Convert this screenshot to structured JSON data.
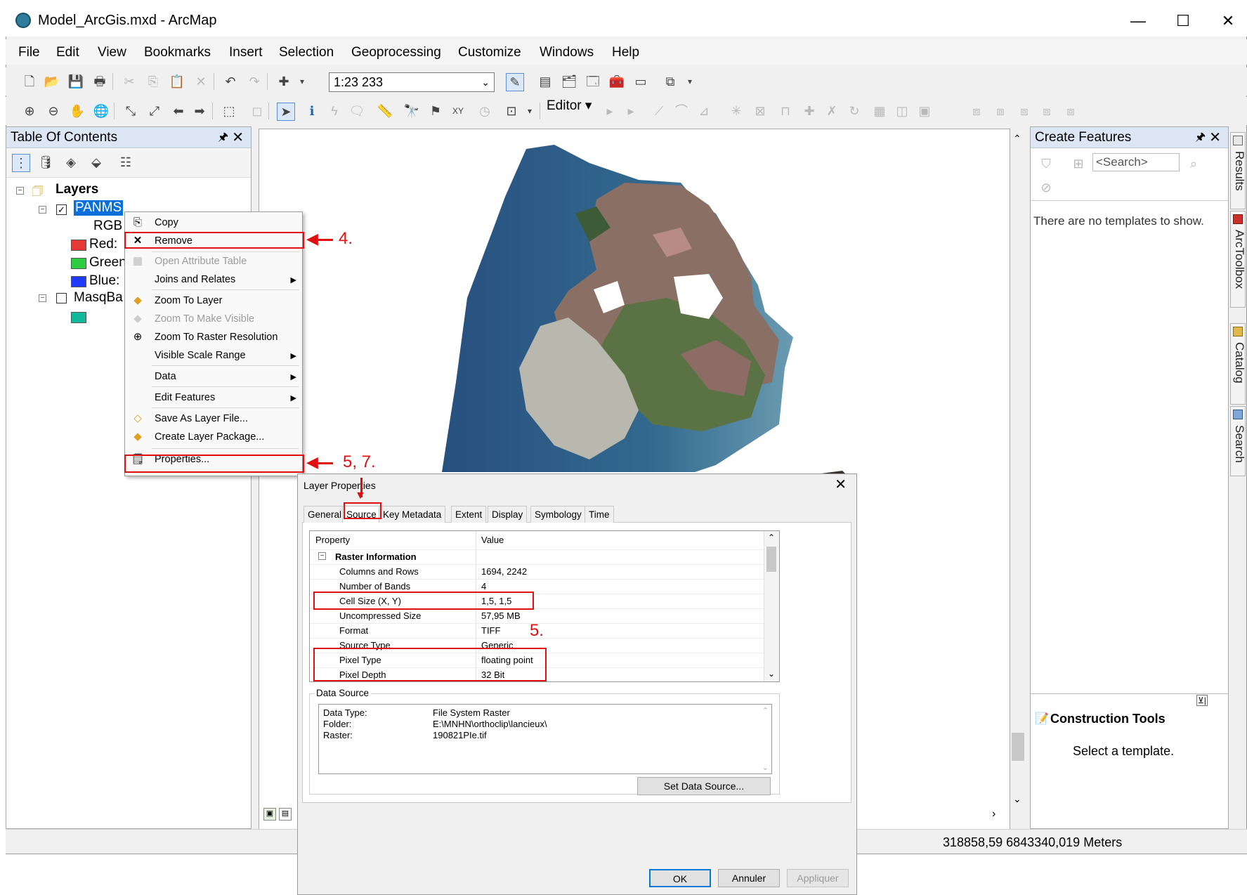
{
  "window": {
    "title": "Model_ArcGis.mxd - ArcMap",
    "controls": [
      "—",
      "☐",
      "✕"
    ]
  },
  "menu": [
    "File",
    "Edit",
    "View",
    "Bookmarks",
    "Insert",
    "Selection",
    "Geoprocessing",
    "Customize",
    "Windows",
    "Help"
  ],
  "toolbar": {
    "scale": "1:23 233",
    "editor_label": "Editor ▾"
  },
  "toc": {
    "title": "Table Of Contents",
    "root": "Layers",
    "layer1": "PANMS",
    "layer1_sub": "RGB",
    "bands": [
      "Red:",
      "Green",
      "Blue:"
    ],
    "layer2": "MasqBa",
    "colors": {
      "red": "#e53935",
      "green": "#2ecc40",
      "blue": "#1e3bff",
      "mask": "#12b898",
      "selection": "#0a6fd8"
    }
  },
  "context_menu": [
    {
      "label": "Copy",
      "icon": "copy-icon",
      "dim": false
    },
    {
      "label": "Remove",
      "icon": "remove-icon",
      "dim": false
    },
    {
      "label": "Open Attribute Table",
      "icon": "table-icon",
      "dim": true
    },
    {
      "label": "Joins and Relates",
      "icon": "",
      "dim": false,
      "submenu": true
    },
    {
      "label": "Zoom To Layer",
      "icon": "zoom-layer-icon",
      "dim": false
    },
    {
      "label": "Zoom To Make Visible",
      "icon": "zoom-visible-icon",
      "dim": true
    },
    {
      "label": "Zoom To Raster Resolution",
      "icon": "zoom-raster-icon",
      "dim": false
    },
    {
      "label": "Visible Scale Range",
      "icon": "",
      "dim": false,
      "submenu": true
    },
    {
      "label": "Data",
      "icon": "",
      "dim": false,
      "submenu": true
    },
    {
      "label": "Edit Features",
      "icon": "",
      "dim": false,
      "submenu": true
    },
    {
      "label": "Save As Layer File...",
      "icon": "layer-file-icon",
      "dim": false
    },
    {
      "label": "Create Layer Package...",
      "icon": "package-icon",
      "dim": false
    },
    {
      "label": "Properties...",
      "icon": "properties-icon",
      "dim": false
    }
  ],
  "annotations": {
    "step4": "4.",
    "step57": "5, 7.",
    "step5": "5."
  },
  "create_features": {
    "title": "Create Features",
    "search_placeholder": "<Search>",
    "empty_message": "There are no templates to show.",
    "construction_title": "Construction Tools",
    "construction_message": "Select a template."
  },
  "side_tabs": [
    "Results",
    "ArcToolbox",
    "Catalog",
    "Search"
  ],
  "status": {
    "coordinates": "318858,59  6843340,019 Meters"
  },
  "dialog": {
    "title": "Layer Properties",
    "tabs": [
      "General",
      "Source",
      "Key Metadata",
      "Extent",
      "Display",
      "Symbology",
      "Time"
    ],
    "grid_headers": [
      "Property",
      "Value"
    ],
    "section": "Raster Information",
    "rows": [
      {
        "property": "Columns and Rows",
        "value": "1694, 2242"
      },
      {
        "property": "Number of Bands",
        "value": "4"
      },
      {
        "property": "Cell Size (X, Y)",
        "value": "1,5, 1,5"
      },
      {
        "property": "Uncompressed Size",
        "value": "57,95 MB"
      },
      {
        "property": "Format",
        "value": "TIFF"
      },
      {
        "property": "Source Type",
        "value": "Generic"
      },
      {
        "property": "Pixel Type",
        "value": "floating point"
      },
      {
        "property": "Pixel Depth",
        "value": "32 Bit"
      }
    ],
    "data_source_label": "Data Source",
    "data_source": [
      {
        "key": "Data Type:",
        "value": "File System Raster"
      },
      {
        "key": "Folder:",
        "value": "E:\\MNHN\\orthoclip\\lancieux\\"
      },
      {
        "key": "Raster:",
        "value": "190821PIe.tif"
      }
    ],
    "set_source_button": "Set Data Source...",
    "ok": "OK",
    "cancel": "Annuler",
    "apply": "Appliquer"
  }
}
